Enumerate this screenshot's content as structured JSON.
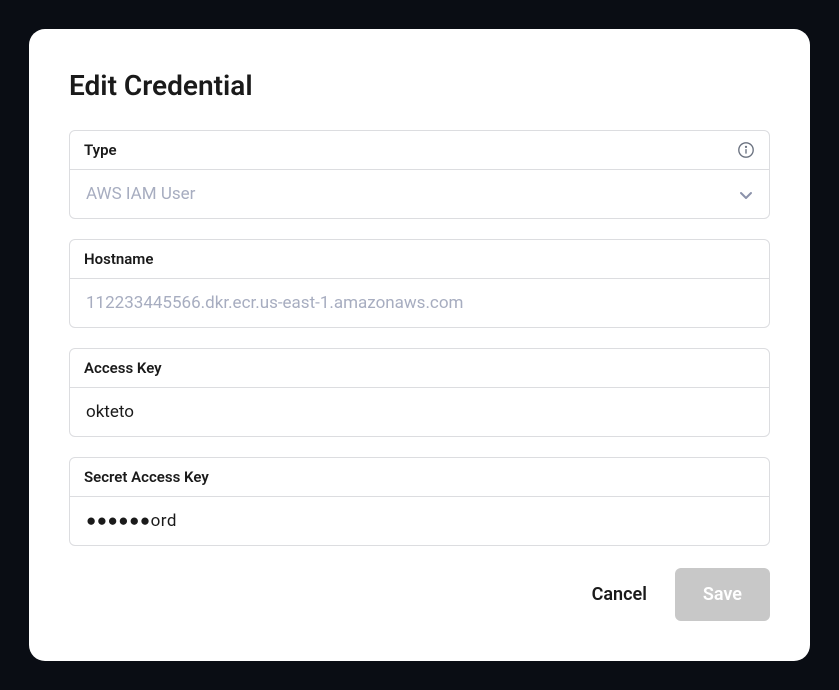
{
  "modal": {
    "title": "Edit Credential"
  },
  "fields": {
    "type": {
      "label": "Type",
      "value": "AWS IAM User"
    },
    "hostname": {
      "label": "Hostname",
      "placeholder": "112233445566.dkr.ecr.us-east-1.amazonaws.com",
      "value": ""
    },
    "accessKey": {
      "label": "Access Key",
      "value": "okteto"
    },
    "secretAccessKey": {
      "label": "Secret Access Key",
      "displayValue": "●●●●●●ord"
    }
  },
  "actions": {
    "cancel": "Cancel",
    "save": "Save"
  }
}
